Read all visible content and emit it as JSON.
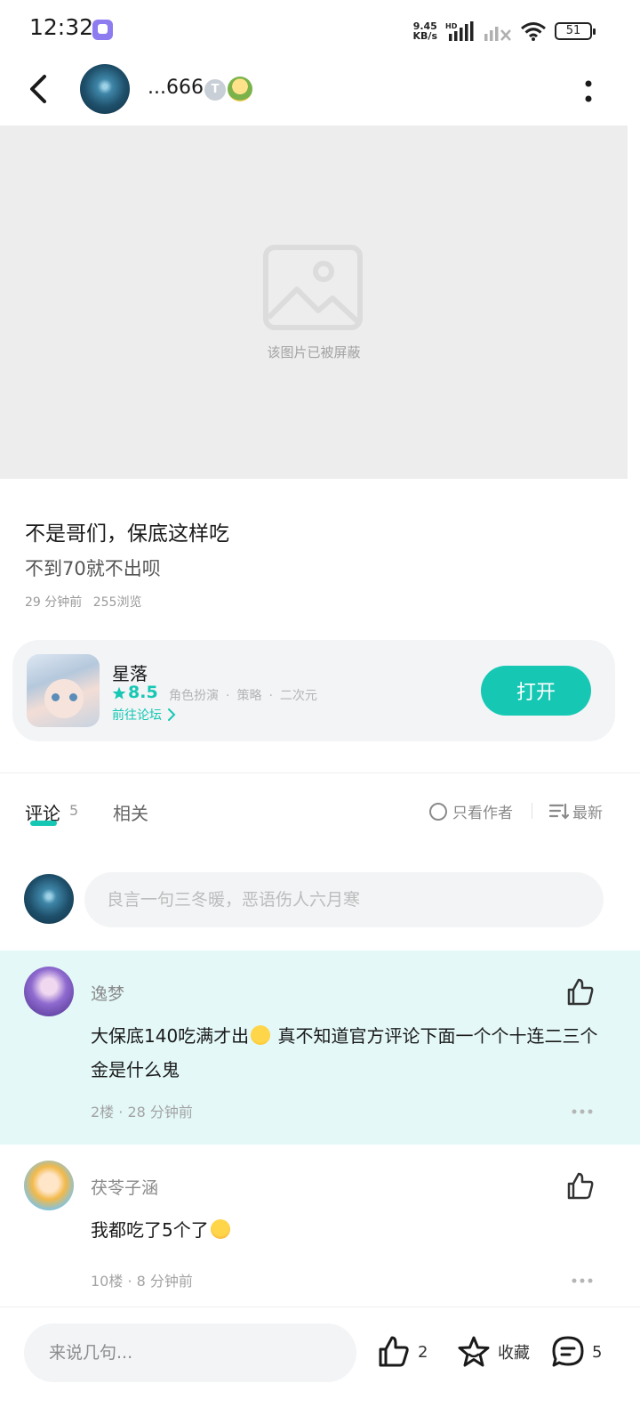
{
  "status_bar": {
    "time": "12:32",
    "net_speed_value": "9.45",
    "net_speed_unit": "KB/s",
    "network_type": "HD",
    "battery": "51"
  },
  "header": {
    "author_name": "...666",
    "author_badge": "T"
  },
  "post": {
    "blocked_image_text": "该图片已被屏蔽",
    "title": "不是哥们，保底这样吃",
    "body": "不到70就不出呗",
    "time_ago": "29 分钟前",
    "views": "255浏览"
  },
  "game_card": {
    "name": "星落",
    "score": "8.5",
    "tags": [
      "角色扮演",
      "策略",
      "二次元"
    ],
    "tag_separator": "·",
    "forum_link": "前往论坛",
    "open_button": "打开"
  },
  "tabs": {
    "comments_label": "评论",
    "comments_count": "5",
    "related_label": "相关",
    "author_only": "只看作者",
    "sort_label": "最新"
  },
  "comment_input": {
    "placeholder": "良言一句三冬暖，恶语伤人六月寒"
  },
  "comments": [
    {
      "user": "逸梦",
      "text_before_emoji": "大保底140吃满才出",
      "emoji": "cool-face-emoji",
      "text_after_emoji": " 真不知道官方评论下面一个个十连二三个金是什么鬼",
      "floor": "2楼",
      "meta_separator": "·",
      "time": "28 分钟前"
    },
    {
      "user": "茯苓子涵",
      "text_before_emoji": "我都吃了5个了",
      "emoji": "crying-face-emoji",
      "text_after_emoji": "",
      "floor": "10楼",
      "meta_separator": "·",
      "time": "8 分钟前"
    }
  ],
  "bottom_bar": {
    "input_placeholder": "来说几句...",
    "likes": "2",
    "favorite_label": "收藏",
    "comments": "5"
  },
  "colors": {
    "accent": "#16c8b3",
    "highlight_bg": "#e4f8f8",
    "card_bg": "#f2f4f6",
    "blocked_bg": "#ededed"
  }
}
